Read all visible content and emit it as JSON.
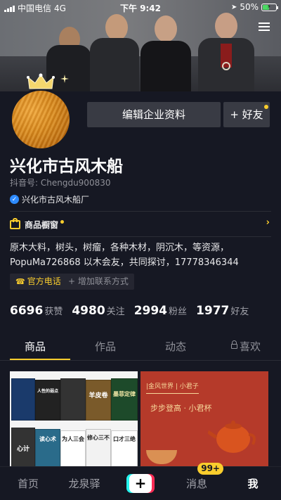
{
  "status_bar": {
    "carrier": "中国电信",
    "network": "4G",
    "time": "下午 9:42",
    "battery_text": "50%",
    "battery_level": 0.5
  },
  "profile": {
    "name": "兴化市古风木船",
    "douyin_id": "抖音号: Chengdu900830",
    "verified_org": "兴化市古风木船厂",
    "edit_button": "编辑企业资料",
    "add_friend_button": "+ 好友"
  },
  "shop_window": {
    "label": "商品橱窗"
  },
  "bio": {
    "line1": "原木大料，树头，树瘤，各种木材，阴沉木，等资源，",
    "line2": "PopuMa726868 以木会友，共同探讨，17778346344"
  },
  "contact": {
    "phone_label": "官方电话",
    "add_contact_label": "+ 增加联系方式"
  },
  "stats": [
    {
      "num": "6696",
      "label": "获赞"
    },
    {
      "num": "4980",
      "label": "关注"
    },
    {
      "num": "2994",
      "label": "粉丝"
    },
    {
      "num": "1977",
      "label": "好友"
    }
  ],
  "tabs": [
    "商品",
    "作品",
    "动态",
    "喜欢"
  ],
  "cards": {
    "books": {
      "titles": [
        "人性的弱点",
        "羊皮卷",
        "墨菲定律",
        "心计",
        "读心术",
        "为人三会",
        "修心三不",
        "口才三绝"
      ]
    },
    "tea": {
      "banner": "|金风世界 | 小君子",
      "title": "步步登高 · 小君杯"
    }
  },
  "bottom_nav": {
    "home": "首页",
    "city": "龙泉驿",
    "plus": "+",
    "messages": "消息",
    "messages_badge": "99+",
    "me": "我"
  },
  "colors": {
    "background": "#161823",
    "accent_yellow": "#facd2d",
    "verify_blue": "#2e8bff"
  }
}
